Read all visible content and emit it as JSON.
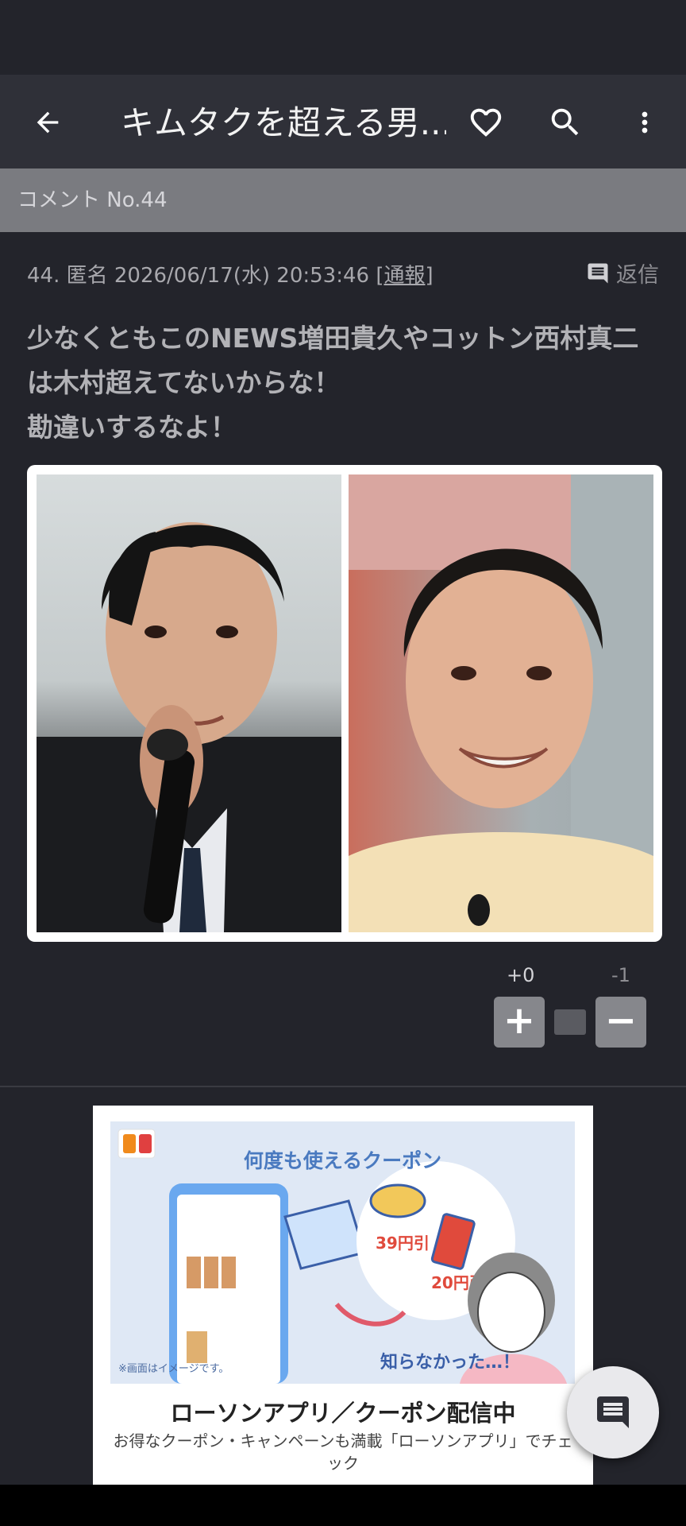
{
  "app_bar": {
    "title": "キムタクを超える男..."
  },
  "section": {
    "label": "コメント No.44"
  },
  "comment": {
    "meta_prefix": "44. 匿名 2026/06/17(水) 20:53:46 [",
    "report_label": "通報",
    "meta_suffix": "]",
    "reply_label": "返信",
    "body_lines": [
      "少なくともこのNEWS増田貴久やコットン西村真二",
      "は木村超えてないからな！",
      "勘違いするなよ！"
    ]
  },
  "votes": {
    "plus_count": "+0",
    "minus_count": "-1",
    "plus_label": "+",
    "minus_label": "−"
  },
  "ad": {
    "image_headline": "何度も使えるクーポン",
    "price_1": "39円引",
    "price_2": "20円引",
    "bubble_text": "知らなかった…！",
    "note": "※画面はイメージです。",
    "title": "ローソンアプリ／クーポン配信中",
    "description": "お得なクーポン・キャンペーンも満載「ローソンアプリ」でチェック"
  },
  "colors": {
    "background": "#23242b",
    "app_bar": "#2f3038",
    "band": "#7a7b80",
    "ad_accent": "#4a7ac0"
  },
  "icons": [
    "back-arrow-icon",
    "heart-icon",
    "search-icon",
    "more-vert-icon",
    "comment-icon",
    "chat-icon"
  ]
}
